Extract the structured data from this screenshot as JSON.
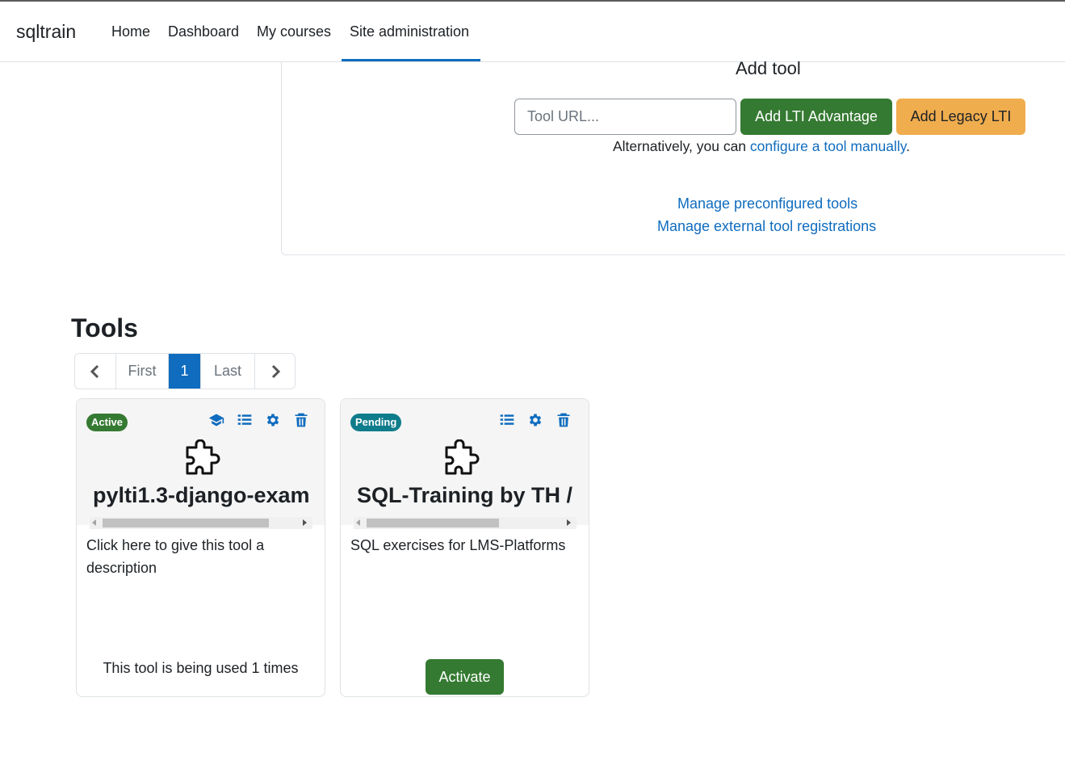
{
  "navbar": {
    "brand": "sqltrain",
    "items": [
      {
        "label": "Home"
      },
      {
        "label": "Dashboard"
      },
      {
        "label": "My courses"
      },
      {
        "label": "Site administration"
      }
    ],
    "active_item": "Site administration"
  },
  "add_tool": {
    "title": "Add tool",
    "url_placeholder": "Tool URL...",
    "url_value": "",
    "add_lti_advantage_label": "Add LTI Advantage",
    "add_legacy_lti_label": "Add Legacy LTI",
    "alternative_prefix": "Alternatively, you can ",
    "alternative_link": "configure a tool manually",
    "alternative_suffix": ".",
    "manage_preconfigured_link": "Manage preconfigured tools",
    "manage_registrations_link": "Manage external tool registrations"
  },
  "tools": {
    "heading": "Tools",
    "pagination": {
      "first_label": "First",
      "current_page": "1",
      "last_label": "Last",
      "prev_icon": "chevron-left-icon",
      "next_icon": "chevron-right-icon"
    },
    "cards": [
      {
        "status": "Active",
        "status_color": "#357a32",
        "icons": [
          "graduation-cap-icon",
          "list-icon",
          "gear-icon",
          "trash-icon"
        ],
        "name": "pylti1.3-django-exam",
        "description": "Click here to give this tool a description",
        "usage_text": "This tool is being used 1 times"
      },
      {
        "status": "Pending",
        "status_color": "#0f7c8b",
        "icons": [
          "list-icon",
          "gear-icon",
          "trash-icon"
        ],
        "name": "SQL-Training by TH /",
        "description": "SQL exercises for LMS-Platforms",
        "activate_label": "Activate"
      }
    ]
  },
  "colors": {
    "primary": "#0f6cbf",
    "success": "#357a32",
    "warning": "#f0ad4e",
    "info": "#0f7c8b"
  }
}
